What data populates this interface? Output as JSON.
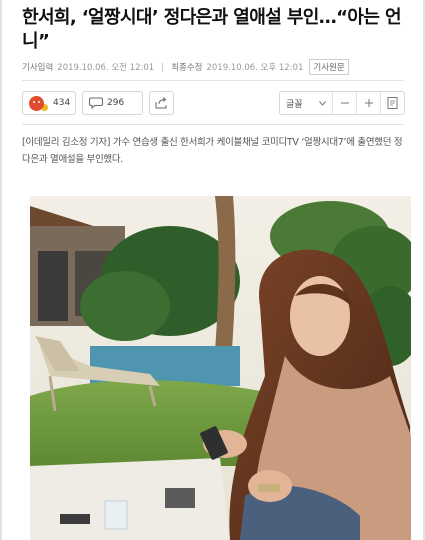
{
  "article": {
    "headline": "한서희, ‘얼짱시대’ 정다은과 열애설 부인…“아는 언니”",
    "meta": {
      "published_label": "기사입력",
      "published_value": "2019.10.06. 오전 12:01",
      "modified_label": "최종수정",
      "modified_value": "2019.10.06. 오후 12:01",
      "original_label": "기사원문"
    },
    "reactions": {
      "count": "434"
    },
    "comments": {
      "count": "296"
    },
    "font_label": "글꼴",
    "lead": "[이데일리 김소정 기자] 가수 연습생 출신 한서희가 케이블채널 코미디TV ‘얼짱시대7’에 출연했던 정다은과 열애설을 부인했다."
  },
  "colors": {
    "reaction_angry": "#e04a2f",
    "reaction_yellow": "#f2b61e"
  },
  "icons": {
    "reaction": "angry-face-icon",
    "comment": "speech-bubble-icon",
    "share": "share-icon",
    "font_caret": "chevron-down-icon",
    "minus": "minus-icon",
    "plus": "plus-icon",
    "print": "print-icon"
  }
}
